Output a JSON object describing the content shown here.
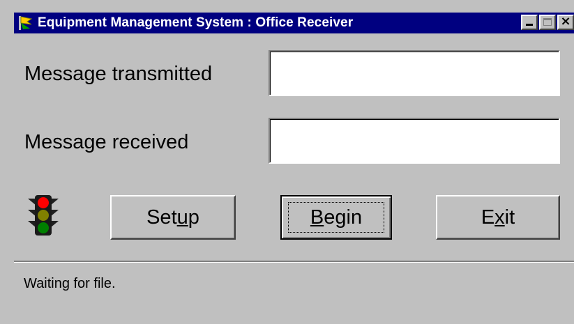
{
  "window": {
    "title": "Equipment Management System : Office Receiver",
    "controls": {
      "minimize_icon": "minimize-icon",
      "maximize_icon": "maximize-icon",
      "close_icon": "close-icon"
    },
    "title_bar_color": "#000080"
  },
  "form": {
    "transmitted_label": "Message transmitted",
    "transmitted_value": "",
    "received_label": "Message received",
    "received_value": ""
  },
  "indicator": {
    "icon": "traffic-light-icon",
    "active_light": "red",
    "colors": {
      "red": "#ff0000",
      "yellow": "#808000",
      "green": "#008000"
    }
  },
  "buttons": {
    "setup": {
      "prefix": "Set",
      "accel": "u",
      "suffix": "p"
    },
    "begin": {
      "prefix": "",
      "accel": "B",
      "suffix": "egin"
    },
    "exit": {
      "prefix": "E",
      "accel": "x",
      "suffix": "it"
    }
  },
  "status": {
    "text": "Waiting for file."
  }
}
